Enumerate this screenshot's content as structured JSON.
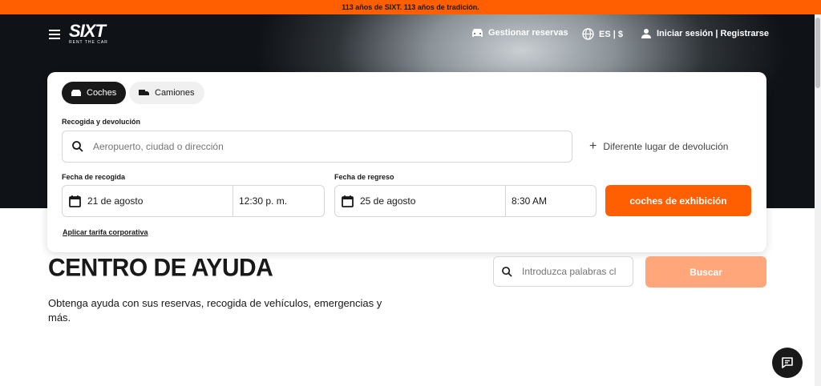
{
  "promo": {
    "text": "113 años de SIXT. 113 años de tradición."
  },
  "header": {
    "logo_word": "SIXT",
    "logo_sub": "RENT THE CAR",
    "manage": "Gestionar reservas",
    "locale": "ES | $",
    "login": "Iniciar sesión | Registrarse"
  },
  "booking": {
    "tabs": [
      {
        "label": "Coches",
        "icon": "car-icon"
      },
      {
        "label": "Camiones",
        "icon": "truck-icon"
      }
    ],
    "location_label": "Recogida y devolución",
    "location_placeholder": "Aeropuerto, ciudad o dirección",
    "different_return": "Diferente lugar de devolución",
    "pickup_label": "Fecha de recogida",
    "pickup_date": "21 de agosto",
    "pickup_time": "12:30 p. m.",
    "return_label": "Fecha de regreso",
    "return_date": "25 de agosto",
    "return_time": "8:30 AM",
    "cta": "coches de exhibición",
    "corporate": "Aplicar tarifa corporativa"
  },
  "help": {
    "title": "CENTRO DE AYUDA",
    "description": "Obtenga ayuda con sus reservas, recogida de vehículos, emergencias y más.",
    "search_placeholder": "Introduzca palabras cl",
    "search_button": "Buscar"
  },
  "colors": {
    "accent": "#ff5f00",
    "accent_light": "#ffa67a",
    "dark": "#191919"
  }
}
